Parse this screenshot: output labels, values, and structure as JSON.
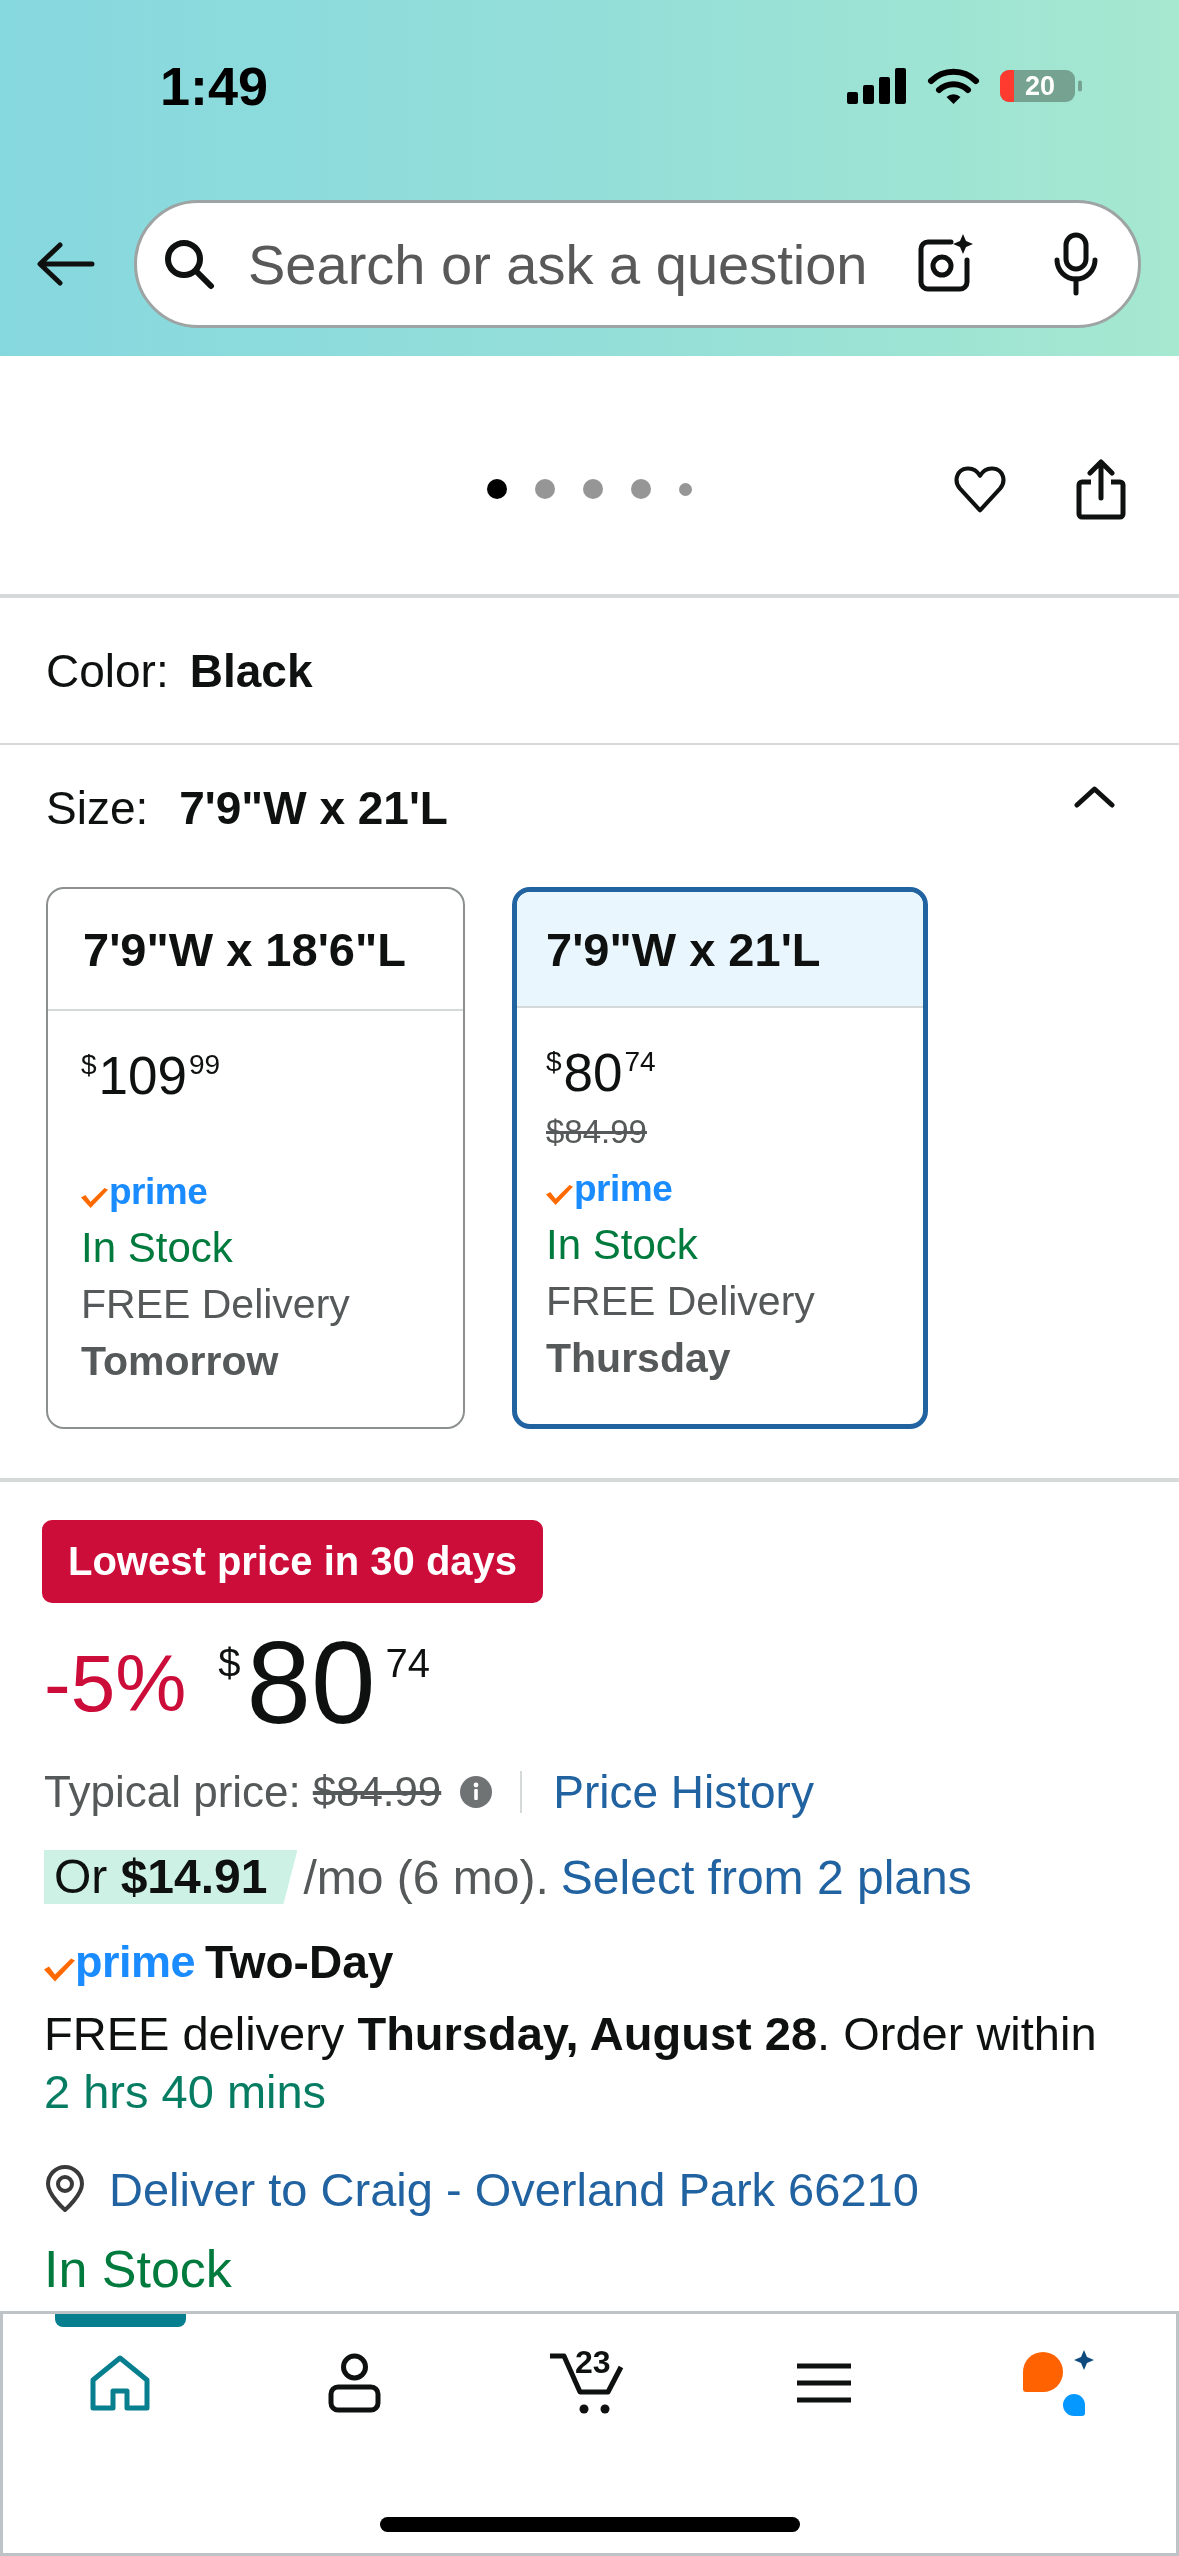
{
  "status_bar": {
    "time": "1:49",
    "battery": "20"
  },
  "search": {
    "placeholder": "Search or ask a question"
  },
  "gallery": {
    "dots": [
      {
        "kind": "full",
        "selected": true
      },
      {
        "kind": "full",
        "selected": false
      },
      {
        "kind": "full",
        "selected": false
      },
      {
        "kind": "full",
        "selected": false
      },
      {
        "kind": "small",
        "selected": false
      }
    ]
  },
  "color": {
    "label": "Color:",
    "value": "Black"
  },
  "size": {
    "label": "Size:",
    "value": "7'9\"W x 21'L",
    "expanded": true,
    "options": [
      {
        "title": "7'9\"W x 18'6\"L",
        "selected": false,
        "currency": "$",
        "whole": "109",
        "fraction": "99",
        "prime": "prime",
        "availability": "In Stock",
        "delivery": "FREE Delivery",
        "delivery_day": "Tomorrow"
      },
      {
        "title": "7'9\"W x 21'L",
        "selected": true,
        "currency": "$",
        "whole": "80",
        "fraction": "74",
        "list_price": "$84.99",
        "prime": "prime",
        "availability": "In Stock",
        "delivery": "FREE Delivery",
        "delivery_day": "Thursday"
      }
    ]
  },
  "deal": {
    "badge": "Lowest price in 30 days",
    "discount": "-5%",
    "currency": "$",
    "whole": "80",
    "fraction": "74",
    "typical_label": "Typical price:",
    "typical_price": "$84.99",
    "history_link": "Price History"
  },
  "financing": {
    "highlight": "Or **$14.91**",
    "terms": "/mo (6 mo).",
    "link": "Select from 2 plans"
  },
  "delivery": {
    "prime": "prime",
    "speed": "Two-Day",
    "message": "FREE delivery **Thursday, August 28**. Order within",
    "countdown": "2 hrs 40 mins"
  },
  "location": {
    "link": "Deliver to Craig - Overland Park 66210"
  },
  "availability": "In Stock",
  "tab_bar": {
    "items": [
      {
        "kind": "home",
        "selected": true
      },
      {
        "kind": "account",
        "selected": false
      },
      {
        "kind": "cart",
        "selected": false,
        "count": "23"
      },
      {
        "kind": "menu",
        "selected": false
      },
      {
        "kind": "assistant",
        "selected": false
      }
    ]
  }
}
